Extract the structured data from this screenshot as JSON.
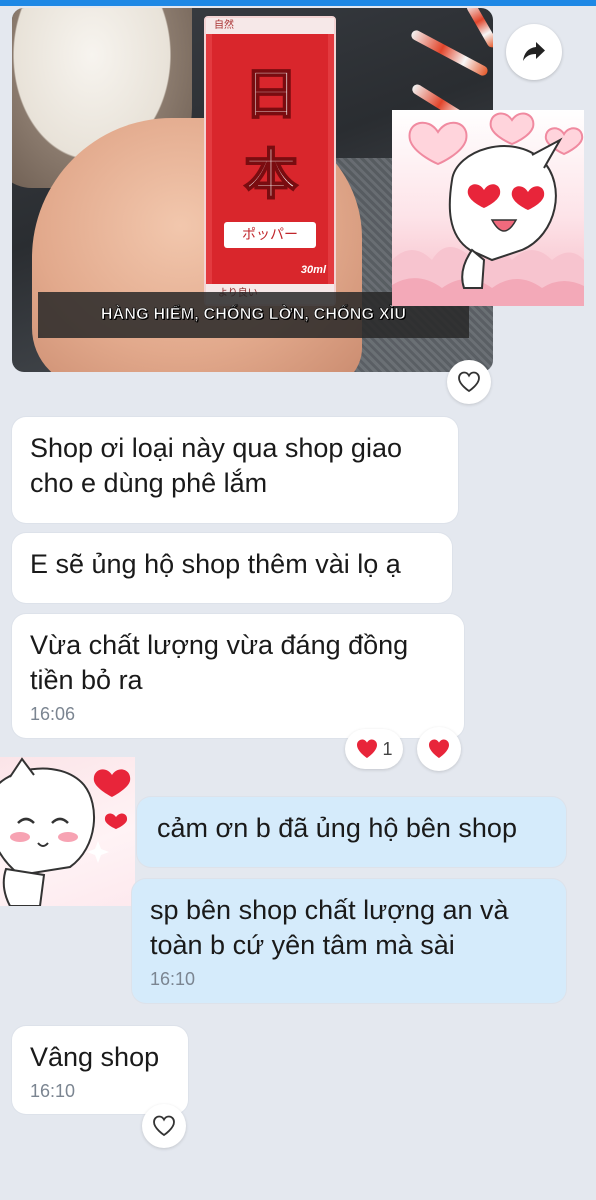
{
  "photo": {
    "caption": "HÀNG HIẾM, CHỐNG LỜN, CHỐNG XÌU",
    "bottle": {
      "cap_text": "自然",
      "kanji_1": "日",
      "kanji_2": "本",
      "label": "ポッパー",
      "volume": "30ml",
      "footer": "より良い"
    }
  },
  "messages": [
    {
      "id": "m1",
      "side": "them",
      "text": "Shop ơi loại này qua shop giao cho e dùng phê lắm"
    },
    {
      "id": "m2",
      "side": "them",
      "text": "E sẽ ủng hộ shop thêm vài lọ ạ"
    },
    {
      "id": "m3",
      "side": "them",
      "text": "Vừa chất lượng vừa đáng đồng tiền bỏ ra",
      "time": "16:06"
    },
    {
      "id": "m4",
      "side": "me",
      "text": "cảm ơn b đã ủng hộ bên shop"
    },
    {
      "id": "m5",
      "side": "me",
      "text": "sp bên shop chất lượng an và toàn b cứ yên tâm mà sài",
      "time": "16:10"
    },
    {
      "id": "m6",
      "side": "them",
      "text": "Vâng shop",
      "time": "16:10"
    }
  ],
  "reactions": {
    "heart_count": "1"
  },
  "icons": {
    "share": "share-arrow-icon",
    "react": "heart-outline-icon",
    "reaction": "red-heart-icon"
  },
  "colors": {
    "background": "#e4e8ef",
    "incoming_bubble": "#ffffff",
    "outgoing_bubble": "#d5ebfb",
    "timestamp": "#7b8591",
    "heart": "#e8253a"
  }
}
